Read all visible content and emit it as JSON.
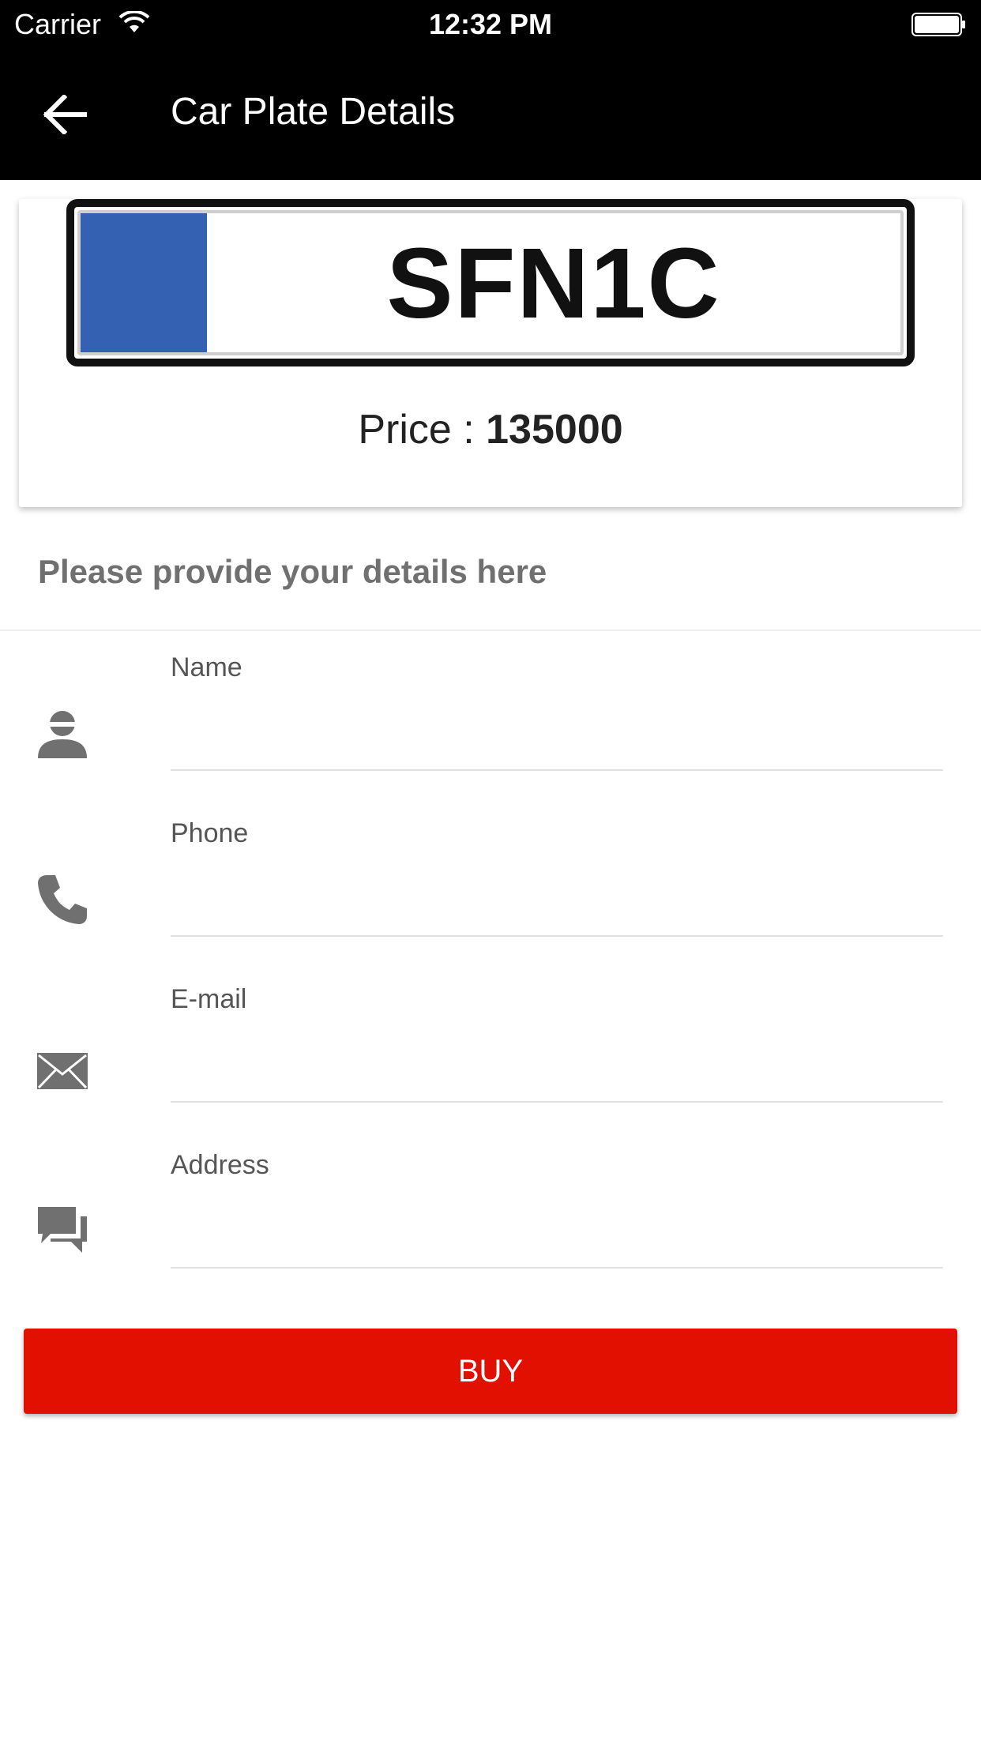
{
  "status_bar": {
    "carrier": "Carrier",
    "time": "12:32 PM",
    "wifi_icon": "wifi-icon",
    "battery_icon": "battery-icon"
  },
  "app_bar": {
    "title": "Car Plate Details",
    "back_icon": "arrow-left-icon",
    "background": "#000000"
  },
  "plate": {
    "number": "SFN1C",
    "band_color": "#3461b2",
    "price_label": "Price : ",
    "price_value": "135000"
  },
  "form": {
    "header": "Please provide your details here",
    "fields": [
      {
        "label": "Name",
        "icon": "person-icon",
        "value": ""
      },
      {
        "label": "Phone",
        "icon": "phone-icon",
        "value": ""
      },
      {
        "label": "E-mail",
        "icon": "envelope-icon",
        "value": ""
      },
      {
        "label": "Address",
        "icon": "chat-bubbles-icon",
        "value": ""
      }
    ]
  },
  "buy_button": {
    "label": "BUY",
    "color": "#e11000"
  }
}
